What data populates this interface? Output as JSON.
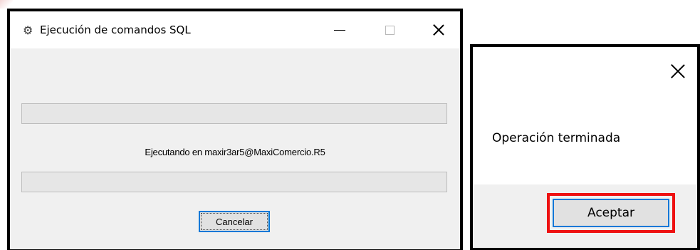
{
  "execution_window": {
    "title": "Ejecución de comandos SQL",
    "app_icon": "gear-icon",
    "controls": {
      "minimize_icon": "minimize-icon",
      "maximize_icon": "maximize-icon",
      "close_icon": "close-icon"
    },
    "progress_top": {
      "value": 0
    },
    "status_text": "Ejecutando en maxir3ar5@MaxiComercio.R5",
    "progress_bottom": {
      "value": 0
    },
    "cancel_label": "Cancelar"
  },
  "message_dialog": {
    "close_icon": "close-icon",
    "message": "Operación terminada",
    "accept_label": "Aceptar"
  },
  "colors": {
    "window_border": "#000000",
    "button_focus": "#0078d7",
    "highlight": "#ee1111",
    "dialog_background": "#f0f0f0"
  }
}
